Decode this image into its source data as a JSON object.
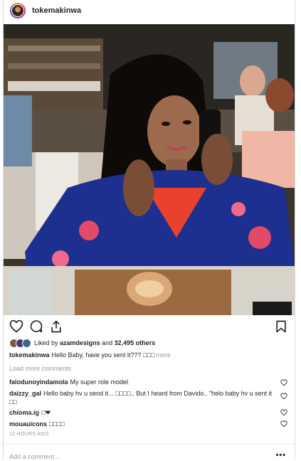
{
  "post": {
    "username": "tokemakinwa",
    "avatar_icon": "profile-avatar"
  },
  "actions": {
    "like_icon": "heart-icon",
    "comment_icon": "comment-icon",
    "share_icon": "share-icon",
    "save_icon": "bookmark-icon"
  },
  "likes": {
    "prefix": "Liked by",
    "first_user": "azamdesigns",
    "and_text": "and",
    "others": "32,495 others"
  },
  "caption": {
    "user": "tokemakinwa",
    "text": "Hello Baby, have you sent it??? □□□",
    "more": "more"
  },
  "load_more_label": "Load more comments",
  "comments": [
    {
      "user": "falodunoyindamola",
      "text": "My super role model"
    },
    {
      "user": "daizzy_gal",
      "text": "Hello baby hv u send it... □□□□.. But I heard from Davido.. \"helo baby hv u sent it □□"
    },
    {
      "user": "chioma.ig",
      "text": "□❤"
    },
    {
      "user": "mouauicons",
      "text": "□□□□"
    }
  ],
  "timestamp": "12 HOURS AGO",
  "add_comment_placeholder": "Add a comment...",
  "more_options": "•••",
  "colors": {
    "text": "#262626",
    "muted": "#999999",
    "border": "#dbdbdb"
  }
}
